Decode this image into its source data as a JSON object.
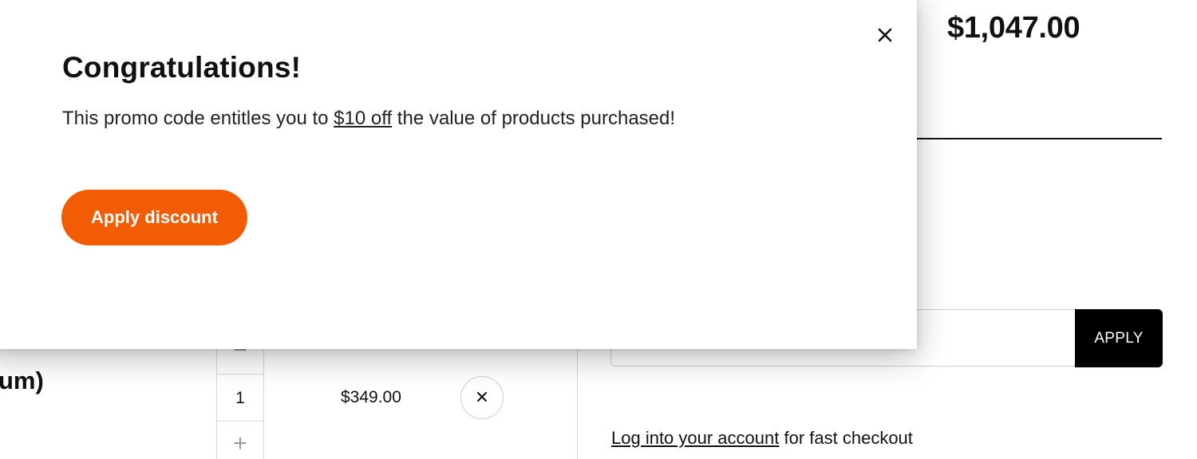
{
  "summary": {
    "total": "$1,047.00",
    "promo_input_value": "",
    "apply_label": "APPLY",
    "login_link": "Log into your account",
    "login_suffix": " for fast checkout"
  },
  "cart_item": {
    "name_fragment": "um)",
    "qty_minus": "−",
    "quantity": "1",
    "qty_plus": "+",
    "price": "$349.00"
  },
  "modal": {
    "title": "Congratulations!",
    "message_before": "This promo code entitles you to ",
    "message_highlight": "$10 off",
    "message_after": " the value of products purchased!",
    "apply_discount_label": "Apply discount"
  },
  "colors": {
    "accent": "#f25c05",
    "apply_button_bg": "#000000"
  },
  "icons": {
    "modal_close": "close-icon",
    "remove_item": "close-icon"
  }
}
